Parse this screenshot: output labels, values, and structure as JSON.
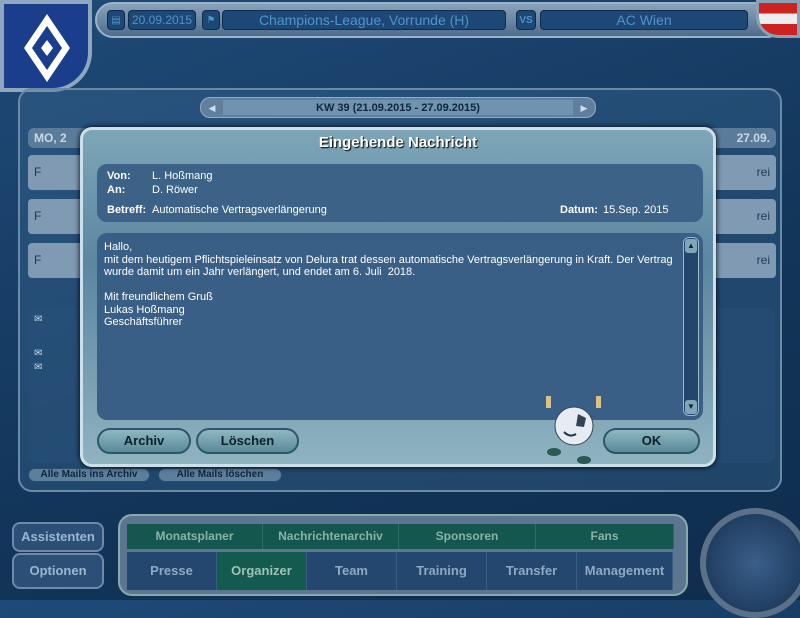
{
  "topbar": {
    "date": "20.09.2015",
    "competition": "Champions-League, Vorrunde (H)",
    "vs_label": "VS",
    "opponent": "AC Wien"
  },
  "week": {
    "label": "KW 39 (21.09.2015 - 27.09.2015)"
  },
  "days": {
    "first": "MO, 2",
    "last": "27.09.",
    "rows": [
      {
        "left": "F",
        "right": "rei"
      },
      {
        "left": "F",
        "right": "rei"
      },
      {
        "left": "F",
        "right": "rei"
      }
    ]
  },
  "mail_buttons": {
    "archive_all": "Alle Mails ins Archiv",
    "delete_all": "Alle Mails löschen"
  },
  "dialog": {
    "title": "Eingehende Nachricht",
    "from_label": "Von:",
    "from": "L. Hoßmang",
    "to_label": "An:",
    "to": "D. Röwer",
    "subject_label": "Betreff:",
    "subject": "Automatische Vertragsverlängerung",
    "date_label": "Datum:",
    "date": "15.Sep. 2015",
    "body": "Hallo,\nmit dem heutigem Pflichtspieleinsatz von Delura trat dessen automatische Vertragsverlängerung in Kraft. Der Vertrag wurde damit um ein Jahr verlängert, und endet am 6. Juli  2018.\n\nMit freundlichem Gruß\nLukas Hoßmang\nGeschäftsführer",
    "archive": "Archiv",
    "delete": "Löschen",
    "ok": "OK"
  },
  "side": {
    "assistants": "Assistenten",
    "options": "Optionen"
  },
  "nav_top": [
    "Monatsplaner",
    "Nachrichtenarchiv",
    "Sponsoren",
    "Fans"
  ],
  "nav_bottom": [
    "Presse",
    "Organizer",
    "Team",
    "Training",
    "Transfer",
    "Management"
  ],
  "nav_active": "Organizer"
}
